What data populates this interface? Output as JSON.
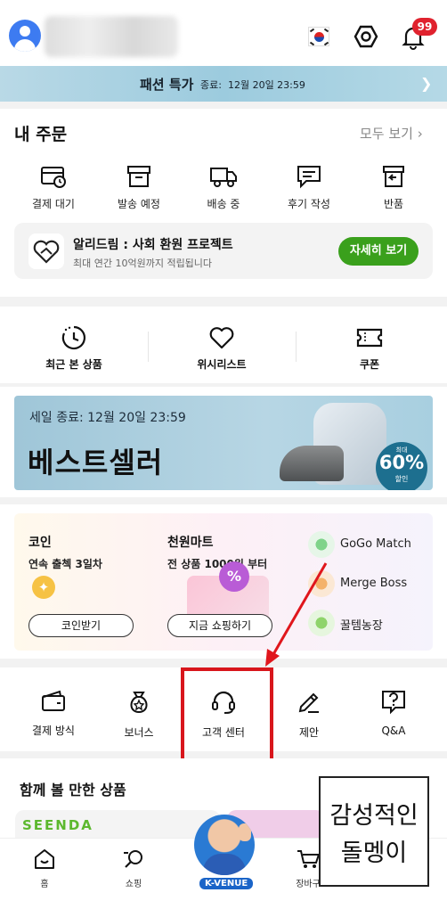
{
  "header": {
    "notification_count": "99",
    "colors": {
      "badge": "#e0222e",
      "avatar": "#3d7bf1"
    }
  },
  "sale_banner": {
    "title": "패션 특가",
    "end_label": "종료:",
    "end_time": "12월 20일 23:59"
  },
  "orders": {
    "title": "내 주문",
    "view_all": "모두 보기",
    "items": [
      {
        "label": "결제 대기",
        "icon": "payment-pending-icon"
      },
      {
        "label": "발송 예정",
        "icon": "box-icon"
      },
      {
        "label": "배송 중",
        "icon": "truck-icon"
      },
      {
        "label": "후기 작성",
        "icon": "review-icon"
      },
      {
        "label": "반품",
        "icon": "return-icon"
      }
    ]
  },
  "promo": {
    "title": "알리드림 : 사회 환원 프로젝트",
    "subtitle": "최대 연간 10억원까지 적립됩니다",
    "button": "자세히 보기",
    "button_color": "#3aa01c"
  },
  "quick_links": [
    {
      "label": "최근 본 상품",
      "icon": "recent-clock-icon"
    },
    {
      "label": "위시리스트",
      "icon": "heart-icon"
    },
    {
      "label": "쿠폰",
      "icon": "coupon-icon"
    }
  ],
  "bestseller": {
    "subtitle": "세일 종료: 12월 20일 23:59",
    "title": "베스트셀러",
    "discount_top": "최대",
    "discount": "60%",
    "discount_bottom": "할인"
  },
  "coins": {
    "coin_title": "코인",
    "coin_desc": "연속 출첵 3일차",
    "coin_button": "코인받기",
    "mart_title": "천원마트",
    "mart_desc": "전 상품 1000원 부터",
    "mart_button": "지금 쇼핑하기",
    "games": [
      {
        "label": "GoGo Match"
      },
      {
        "label": "Merge Boss"
      },
      {
        "label": "꿀템농장"
      }
    ]
  },
  "services": [
    {
      "label": "결제 방식",
      "icon": "wallet-icon"
    },
    {
      "label": "보너스",
      "icon": "bonus-bag-icon"
    },
    {
      "label": "고객 센터",
      "icon": "headset-icon"
    },
    {
      "label": "제안",
      "icon": "pencil-icon"
    },
    {
      "label": "Q&A",
      "icon": "question-icon"
    }
  ],
  "recommend": {
    "title": "함께 볼 만한 상품",
    "brand": "SEENDA"
  },
  "tabbar": [
    {
      "label": "홈",
      "icon": "home-icon"
    },
    {
      "label": "쇼핑",
      "icon": "search-bag-icon"
    },
    {
      "label": "K-VENUE",
      "icon": "k-venue-icon"
    },
    {
      "label": "장바구",
      "icon": "cart-icon"
    }
  ],
  "watermark": {
    "line1": "감성적인",
    "line2": "돌멩이"
  }
}
